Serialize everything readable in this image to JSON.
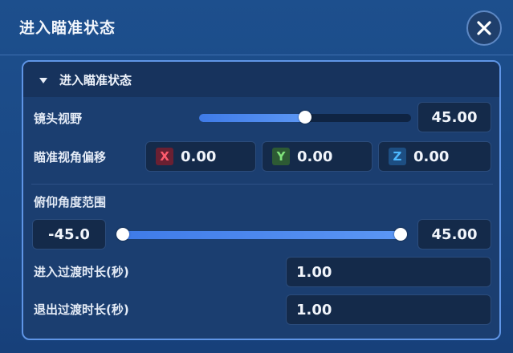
{
  "window": {
    "title": "进入瞄准状态",
    "close_icon": "close-icon"
  },
  "group": {
    "title": "进入瞄准状态",
    "caret_icon": "caret-down-icon"
  },
  "fov": {
    "label": "镜头视野",
    "value": "45.00",
    "slider_fraction": 0.5
  },
  "offset": {
    "label": "瞄准视角偏移",
    "x_tag": "X",
    "x_value": "0.00",
    "y_tag": "Y",
    "y_value": "0.00",
    "z_tag": "Z",
    "z_value": "0.00"
  },
  "pitch": {
    "label": "俯仰角度范围",
    "min_value": "-45.0",
    "max_value": "45.00",
    "range_fraction": [
      0.0,
      1.0
    ]
  },
  "enter_transition": {
    "label": "进入过渡时长(秒)",
    "value": "1.00"
  },
  "exit_transition": {
    "label": "退出过渡时长(秒)",
    "value": "1.00"
  },
  "colors": {
    "accent": "#5b96f4",
    "x_axis": "#ff5c6e",
    "y_axis": "#7fe37a",
    "z_axis": "#4db8ff"
  }
}
